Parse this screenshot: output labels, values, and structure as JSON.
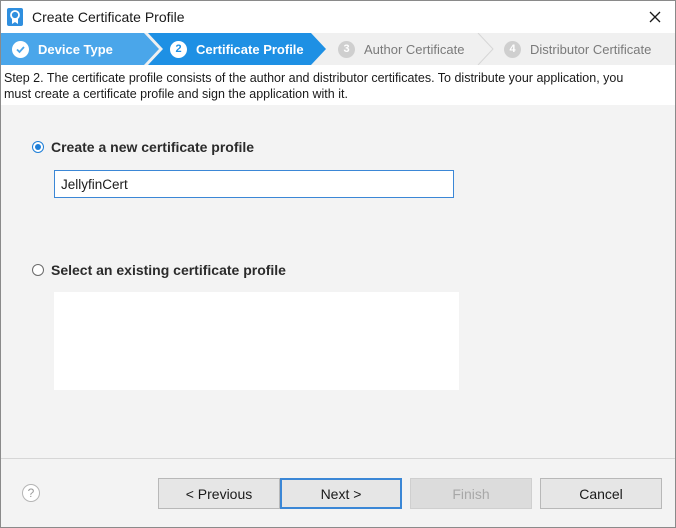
{
  "window": {
    "title": "Create Certificate Profile"
  },
  "steps": [
    {
      "number": "",
      "label": "Device Type",
      "state": "completed"
    },
    {
      "number": "2",
      "label": "Certificate Profile",
      "state": "active"
    },
    {
      "number": "3",
      "label": "Author Certificate",
      "state": "pending"
    },
    {
      "number": "4",
      "label": "Distributor Certificate",
      "state": "pending"
    }
  ],
  "description": "Step 2. The certificate profile consists of the author and distributor certificates. To distribute your application, you must create a certificate profile and sign the application with it.",
  "options": {
    "new_profile": {
      "label": "Create a new certificate profile",
      "selected": true
    },
    "existing_profile": {
      "label": "Select an existing certificate profile",
      "selected": false
    }
  },
  "profile_name": {
    "value": "JellyfinCert"
  },
  "footer": {
    "help_label": "?",
    "prev_label": "< Previous",
    "next_label": "Next >",
    "finish_label": "Finish",
    "cancel_label": "Cancel"
  },
  "colors": {
    "accent": "#1e90e4",
    "step_completed": "#4aa6ea",
    "step_active": "#1e90e4",
    "step_pending": "#f0f0f0"
  }
}
